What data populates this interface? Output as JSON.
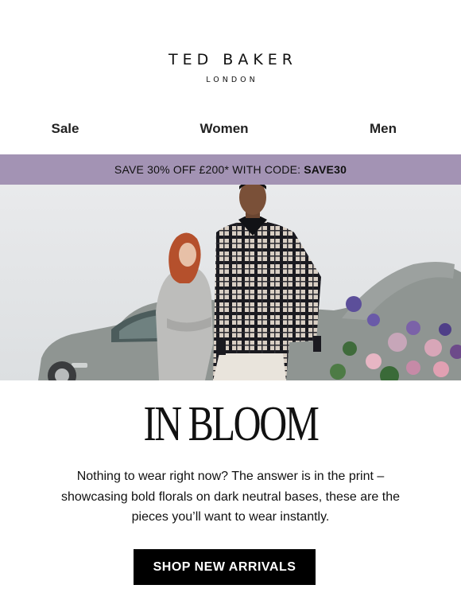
{
  "brand": {
    "name": "TED BAKER",
    "tagline": "LONDON"
  },
  "nav": {
    "items": [
      {
        "label": "Sale"
      },
      {
        "label": "Women"
      },
      {
        "label": "Men"
      }
    ]
  },
  "promo": {
    "text": "SAVE 30% OFF £200* WITH CODE:",
    "code": "SAVE30",
    "background": "#a393b4"
  },
  "hero": {
    "headline": "IN BLOOM"
  },
  "body": {
    "lines": [
      "Nothing to wear right now? The answer is in the print –",
      "showcasing bold florals on dark neutral bases, these are the",
      "pieces you’ll want to wear instantly."
    ]
  },
  "cta": {
    "label": "SHOP NEW ARRIVALS",
    "background": "#000000",
    "color": "#ffffff"
  }
}
